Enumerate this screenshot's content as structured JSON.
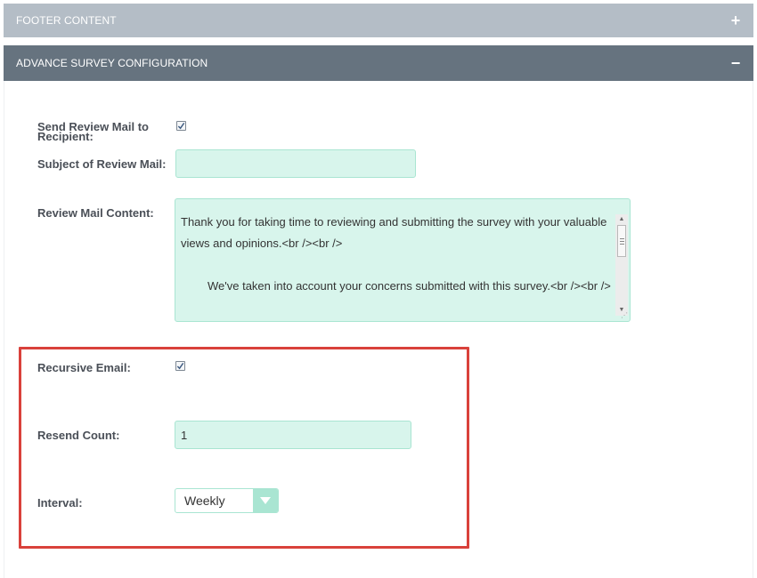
{
  "panels": {
    "footer": {
      "title": "FOOTER CONTENT",
      "toggle_icon": "plus-icon",
      "toggle_glyph": "+"
    },
    "advance": {
      "title": "ADVANCE SURVEY CONFIGURATION",
      "toggle_icon": "minus-icon",
      "toggle_glyph": "−"
    }
  },
  "form": {
    "send_review": {
      "label_line1": "Send Review Mail to",
      "label_line2": "Recipient:",
      "checked": true
    },
    "subject": {
      "label": "Subject of Review Mail:",
      "value": ""
    },
    "content": {
      "label": "Review Mail Content:",
      "line1": "Thank you for taking time to reviewing and submitting the survey with your valuable views and opinions.<br /><br />",
      "line2": "We've taken into account your concerns submitted with this survey.<br /><br />"
    },
    "recursive": {
      "label": "Recursive Email:",
      "checked": true
    },
    "resend_count": {
      "label": "Resend Count:",
      "value": "1"
    },
    "interval": {
      "label": "Interval:",
      "selected": "Weekly"
    }
  },
  "colors": {
    "footer_bar": "#b4bdc6",
    "advance_bar": "#66737f",
    "input_bg": "#d8f5ec",
    "input_border": "#a9e5d2",
    "highlight": "#d9413b",
    "label_text": "#4a4f57"
  }
}
